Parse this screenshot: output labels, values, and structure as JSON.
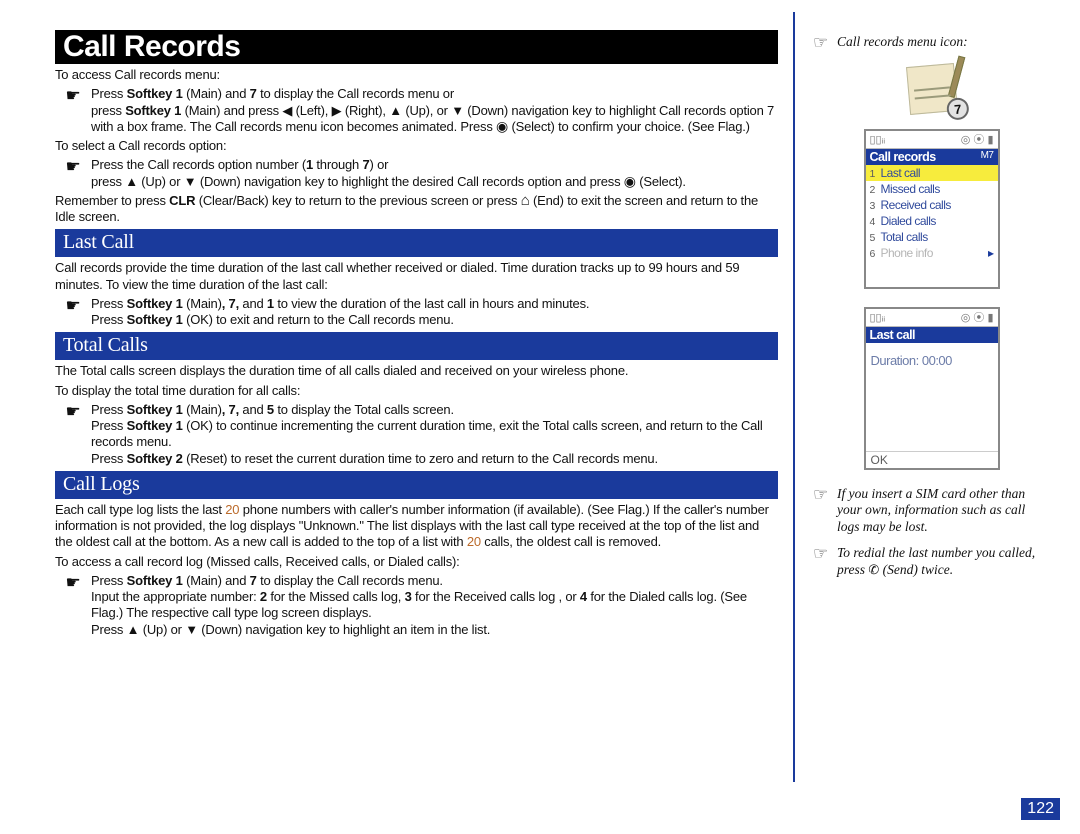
{
  "doc_title": "Call Records",
  "page_number": "122",
  "intro_line": "To access Call records menu:",
  "bullet_a1_pre": "Press ",
  "bullet_a1_sk": "Softkey 1",
  "bullet_a1_mid": " (Main) and ",
  "bullet_a1_seven": "7",
  "bullet_a1_post": " to display the Call records menu or",
  "bullet_a2_pre": "press ",
  "bullet_a2_sk": "Softkey 1",
  "bullet_a2_mid1": " (Main) and press ",
  "bullet_a2_left": " (Left), ",
  "bullet_a2_right": " (Right), ",
  "bullet_a2_up": " (Up), or ",
  "bullet_a2_down": " (Down) navigation key to highlight Call records option 7 with a box frame. The Call records menu icon becomes animated. Press ",
  "bullet_a2_sel": " (Select) to confirm your choice. (See Flag.)",
  "select_line": "To select a Call records option:",
  "bullet_b1_pre": "Press the Call records option number (",
  "bullet_b1_one": "1",
  "bullet_b1_thru": " through ",
  "bullet_b1_seven": "7",
  "bullet_b1_post": ") or",
  "bullet_b2_pre": "press ",
  "bullet_b2_up": " (Up) or ",
  "bullet_b2_down": " (Down) navigation key to highlight the desired Call records option and press ",
  "bullet_b2_sel": " (Select).",
  "remember_pre": "Remember to press ",
  "remember_clr": "CLR",
  "remember_mid": " (Clear/Back) key to return to the previous screen or press ",
  "remember_post": " (End) to exit the screen and return to the Idle screen.",
  "sect1": "Last Call",
  "s1_p1": "Call records provide the time duration of the last call whether received or dialed. Time duration tracks up to 99 hours and 59 minutes. To view the time duration of the last call:",
  "s1_b1_pre": "Press ",
  "s1_b1_sk": "Softkey 1",
  "s1_b1_mid": " (Main)",
  "s1_b1_comma": ", 7,",
  "s1_b1_and": " and ",
  "s1_b1_one": "1",
  "s1_b1_post": " to view the duration of the last call in hours and minutes.",
  "s1_b2_pre": "Press ",
  "s1_b2_sk": "Softkey 1",
  "s1_b2_post": " (OK) to exit and return to the Call records menu.",
  "sect2": "Total Calls",
  "s2_p1": "The Total calls screen displays the duration time of all calls dialed and received on your wireless phone.",
  "s2_p2": "To display the total time duration for all calls:",
  "s2_b1_pre": "Press ",
  "s2_b1_sk": "Softkey 1",
  "s2_b1_mid": " (Main)",
  "s2_b1_comma": ", 7,",
  "s2_b1_and": " and ",
  "s2_b1_five": "5",
  "s2_b1_post": " to display the Total calls screen.",
  "s2_b2_pre": "Press ",
  "s2_b2_sk": "Softkey 1",
  "s2_b2_post": " (OK) to continue incrementing the current duration time, exit the Total calls screen, and return to the Call records menu.",
  "s2_b3_pre": "Press ",
  "s2_b3_sk": "Softkey 2",
  "s2_b3_post": " (Reset) to reset the current duration time to zero and return to the Call records menu.",
  "sect3": "Call Logs",
  "s3_p1_pre": "Each call type log lists the last ",
  "s3_p1_20a": "20",
  "s3_p1_mid": " phone numbers with caller's number information (if available). (See Flag.) If the caller's number information is not provided, the log displays \"Unknown.\" The list displays with the last call type received at the top of the list and the oldest call at the bottom. As a new call is added to the top of a list with ",
  "s3_p1_20b": "20",
  "s3_p1_post": " calls, the oldest call is removed.",
  "s3_p2": "To access a call record log (Missed calls, Received calls, or Dialed calls):",
  "s3_b1_pre": "Press ",
  "s3_b1_sk": "Softkey 1",
  "s3_b1_mid": " (Main) and ",
  "s3_b1_seven": "7",
  "s3_b1_post": " to display the Call records menu.",
  "s3_b2_pre": "Input the appropriate number: ",
  "s3_b2_two": "2",
  "s3_b2_a": " for the Missed calls log, ",
  "s3_b2_three": "3",
  "s3_b2_b": " for the Received calls log , or ",
  "s3_b2_four": "4",
  "s3_b2_c": " for the Dialed calls log. (See Flag.) The respective call type log screen displays.",
  "s3_b3_pre": "Press ",
  "s3_b3_up": " (Up) or ",
  "s3_b3_down": " (Down) navigation key to highlight an item in the list.",
  "side_ann1": "Call records menu icon:",
  "side_ann2": "If you insert a SIM card other than your own, information such as call logs may be lost.",
  "side_ann3_pre": "To redial the last number you called, press ",
  "side_ann3_post": " (Send) twice.",
  "screen1": {
    "title": "Call records",
    "title_r": "M7",
    "items": [
      {
        "n": "1",
        "label": "Last call"
      },
      {
        "n": "2",
        "label": "Missed calls"
      },
      {
        "n": "3",
        "label": "Received calls"
      },
      {
        "n": "4",
        "label": "Dialed calls"
      },
      {
        "n": "5",
        "label": "Total calls"
      },
      {
        "n": "6",
        "label": "Phone info"
      }
    ],
    "status_l": "▯▯ᵢᵢ",
    "status_r": "◎ ⦿ ▮"
  },
  "screen2": {
    "title": "Last call",
    "body": "Duration:  00:00",
    "soft_l": "OK",
    "status_l": "▯▯ᵢᵢ",
    "status_r": "◎ ⦿ ▮"
  },
  "icon7": "7"
}
